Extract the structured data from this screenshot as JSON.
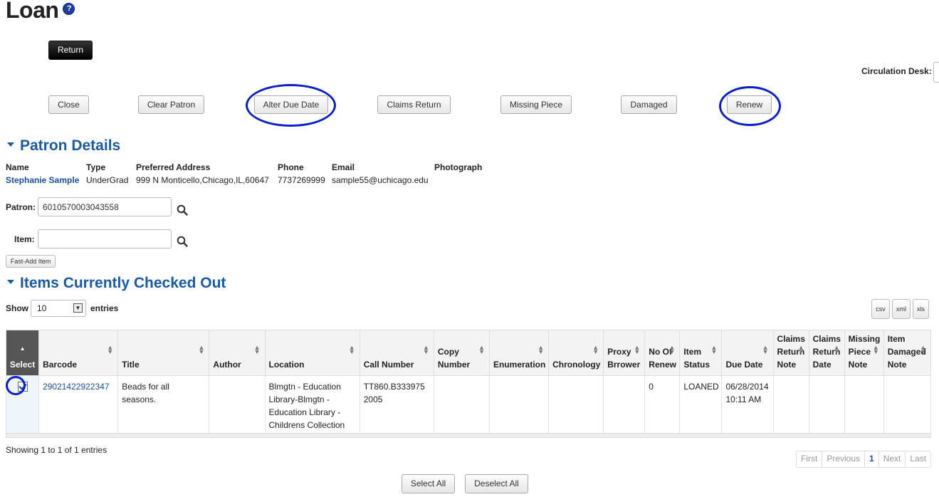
{
  "page": {
    "title": "Loan"
  },
  "toolbar": {
    "return_label": "Return",
    "circulation_desk_label": "Circulation Desk:",
    "buttons": [
      "Close",
      "Clear Patron",
      "Alter Due Date",
      "Claims Return",
      "Missing Piece",
      "Damaged",
      "Renew"
    ]
  },
  "patron_details": {
    "title": "Patron Details",
    "headers": [
      "Name",
      "Type",
      "Preferred Address",
      "Phone",
      "Email",
      "Photograph"
    ],
    "values": {
      "name": "Stephanie Sample",
      "type": "UnderGrad",
      "address": "999 N Monticello,Chicago,IL,60647",
      "phone": "7737269999",
      "email": "sample55@uchicago.edu"
    },
    "patron_label": "Patron:",
    "patron_value": "6010570003043558",
    "item_label": "Item:",
    "item_value": "",
    "fast_add_label": "Fast-Add Item"
  },
  "checked_out": {
    "title": "Items Currently Checked Out",
    "show_label": "Show",
    "entries_value": "10",
    "entries_label": "entries",
    "export_buttons": [
      "csv",
      "xml",
      "xls"
    ],
    "columns": [
      "Select",
      "Barcode",
      "Title",
      "Author",
      "Location",
      "Call Number",
      "Copy Number",
      "Enumeration",
      "Chronology",
      "Proxy Brrower",
      "No Of Renew",
      "Item Status",
      "Due Date",
      "Claims Return Note",
      "Claims Return Date",
      "Missing Piece Note",
      "Item Damaged Note"
    ],
    "rows": [
      {
        "barcode": "29021422922347",
        "title": "Beads for all seasons.",
        "author": "",
        "location": "Blmgtn - Education Library-Blmgtn - Education Library - Childrens Collection",
        "call_number": "TT860.B333975 2005",
        "copy_number": "",
        "enumeration": "",
        "chronology": "",
        "proxy_borrower": "",
        "no_of_renew": "0",
        "item_status": "LOANED",
        "due_date": "06/28/2014 10:11 AM",
        "claims_return_note": "",
        "claims_return_date": "",
        "missing_piece_note": "",
        "item_damaged_note": ""
      }
    ],
    "showing_text": "Showing 1 to 1 of 1 entries",
    "pager": [
      "First",
      "Previous",
      "1",
      "Next",
      "Last"
    ],
    "select_all_label": "Select All",
    "deselect_all_label": "Deselect All"
  },
  "colors": {
    "accent": "#1a5aa6",
    "highlight_circle": "#0a1fd0",
    "select_header": "#555555"
  },
  "icons": {
    "help": "help-icon",
    "search": "search-icon",
    "sort": "sort-icon",
    "dropdown": "chevron-down-icon"
  }
}
